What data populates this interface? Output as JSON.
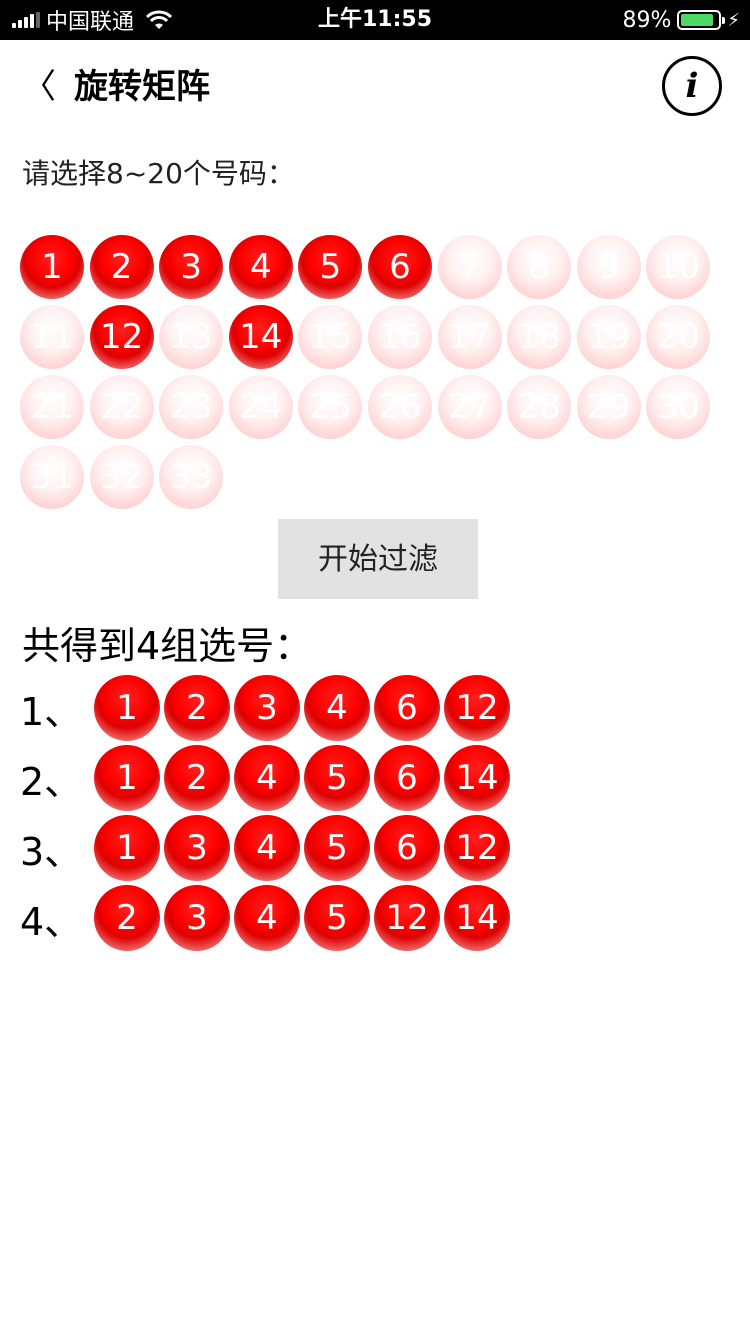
{
  "status_bar": {
    "carrier": "中国联通",
    "time": "上午11:55",
    "battery": "89%",
    "battery_level": 0.89
  },
  "nav": {
    "title": "旋转矩阵",
    "back_icon": "chevron-left-icon",
    "info_icon": "info-icon",
    "info_label": "i",
    "back_label": "〈"
  },
  "prompt": "请选择8~20个号码：",
  "numbers": [
    {
      "label": "1",
      "selected": true
    },
    {
      "label": "2",
      "selected": true
    },
    {
      "label": "3",
      "selected": true
    },
    {
      "label": "4",
      "selected": true
    },
    {
      "label": "5",
      "selected": true
    },
    {
      "label": "6",
      "selected": true
    },
    {
      "label": "7",
      "selected": false
    },
    {
      "label": "8",
      "selected": false
    },
    {
      "label": "9",
      "selected": false
    },
    {
      "label": "10",
      "selected": false
    },
    {
      "label": "11",
      "selected": false
    },
    {
      "label": "12",
      "selected": true
    },
    {
      "label": "13",
      "selected": false
    },
    {
      "label": "14",
      "selected": true
    },
    {
      "label": "15",
      "selected": false
    },
    {
      "label": "16",
      "selected": false
    },
    {
      "label": "17",
      "selected": false
    },
    {
      "label": "18",
      "selected": false
    },
    {
      "label": "19",
      "selected": false
    },
    {
      "label": "20",
      "selected": false
    },
    {
      "label": "21",
      "selected": false
    },
    {
      "label": "22",
      "selected": false
    },
    {
      "label": "23",
      "selected": false
    },
    {
      "label": "24",
      "selected": false
    },
    {
      "label": "25",
      "selected": false
    },
    {
      "label": "26",
      "selected": false
    },
    {
      "label": "27",
      "selected": false
    },
    {
      "label": "28",
      "selected": false
    },
    {
      "label": "29",
      "selected": false
    },
    {
      "label": "30",
      "selected": false
    },
    {
      "label": "31",
      "selected": false
    },
    {
      "label": "32",
      "selected": false
    },
    {
      "label": "33",
      "selected": false
    }
  ],
  "filter_button": "开始过滤",
  "result_title": "共得到4组选号：",
  "results": [
    {
      "index": "1、",
      "balls": [
        "1",
        "2",
        "3",
        "4",
        "6",
        "12"
      ]
    },
    {
      "index": "2、",
      "balls": [
        "1",
        "2",
        "4",
        "5",
        "6",
        "14"
      ]
    },
    {
      "index": "3、",
      "balls": [
        "1",
        "3",
        "4",
        "5",
        "6",
        "12"
      ]
    },
    {
      "index": "4、",
      "balls": [
        "2",
        "3",
        "4",
        "5",
        "12",
        "14"
      ]
    }
  ],
  "colors": {
    "accent": "#ff0000",
    "selected_ball": "#ff0000",
    "unselected_ball": "#ffd4d4",
    "button_bg": "#e2e2e2"
  }
}
